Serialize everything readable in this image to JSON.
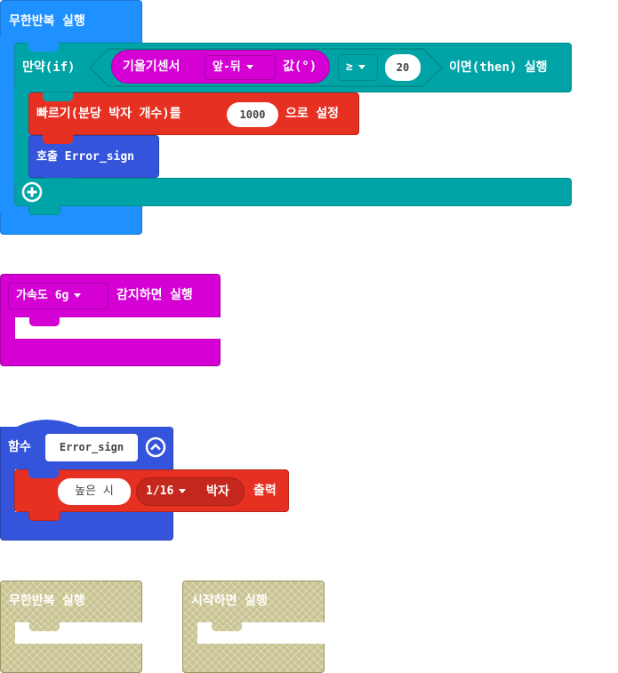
{
  "forever_block": {
    "label": "무한반복 실행"
  },
  "if_block": {
    "if_label": "만약(if)",
    "then_label": "이면(then) 실행"
  },
  "tilt_block": {
    "label": "기울기센서",
    "axis": "앞-뒤",
    "value_label": "값(°)"
  },
  "compare": {
    "operator": "≥",
    "value": "20"
  },
  "tempo_block": {
    "prefix": "빠르기(분당 박자 개수)를",
    "value": "1000",
    "suffix": "으로 설정"
  },
  "call_block": {
    "label": "호출 Error_sign"
  },
  "gesture_block": {
    "option": "가속도 6g",
    "label": "감지하면 실행"
  },
  "function_block": {
    "label": "함수",
    "name": "Error_sign"
  },
  "tone_block": {
    "note": "높은 시",
    "beat": "1/16",
    "beat_suffix": "박자",
    "label": "출력"
  },
  "disabled_forever": {
    "label": "무한반복 실행"
  },
  "disabled_start": {
    "label": "시작하면 실행"
  },
  "colors": {
    "loops": "#1e90ff",
    "logic": "#00a4a6",
    "input": "#d400d4",
    "music": "#e63022",
    "function": "#3455db",
    "disabled": "#c8c390"
  }
}
